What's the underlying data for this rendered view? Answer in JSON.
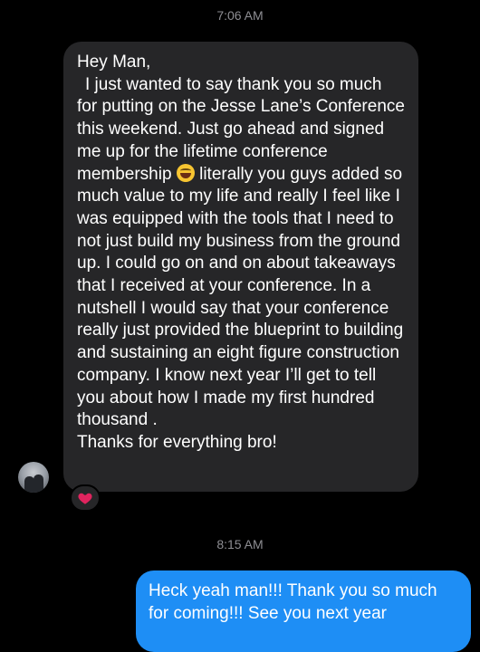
{
  "timestamps": [
    "7:06 AM",
    "8:15 AM"
  ],
  "incoming_message": {
    "greeting": "Hey Man,",
    "body_part1": "I just wanted to say thank you so much for putting on the Jesse Lane’s Conference this weekend. Just go ahead and signed me up for the lifetime conference membership ",
    "emoji_icon": "face-with-tears-of-joy-icon",
    "body_part2": " literally you guys added so much value to my life and really I feel like I was equipped with the tools that I need to not just build my business from the ground up. I could go on and on about takeaways that I received at your conference. In a nutshell I would say that your conference really just provided the blueprint to building and sustaining an eight figure construction company. I know next year I’ll get to tell you about how I made my first hundred thousand .",
    "closing": "Thanks for everything bro!",
    "reaction_icon": "red-heart-icon"
  },
  "outgoing_message": {
    "text": "Heck yeah man!!! Thank you so much for coming!!! See you next year"
  },
  "colors": {
    "background": "#000000",
    "incoming_bubble": "#262628",
    "outgoing_bubble": "#1e8ef5",
    "timestamp": "#8e8e93",
    "heart": "#e0245e"
  }
}
